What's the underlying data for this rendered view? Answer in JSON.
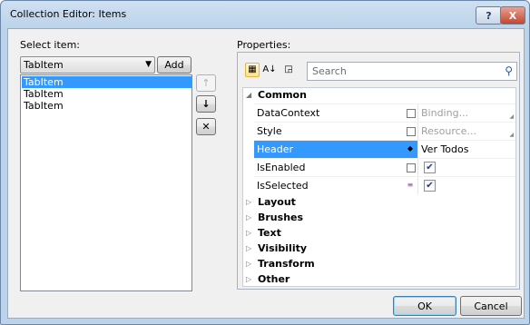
{
  "window": {
    "title": "Collection Editor: Items",
    "help_glyph": "?",
    "close_glyph": "X"
  },
  "left": {
    "label": "Select item:",
    "combo_value": "TabItem",
    "add_label": "Add",
    "items": [
      {
        "label": "TabItem",
        "selected": true
      },
      {
        "label": "TabItem",
        "selected": false
      },
      {
        "label": "TabItem",
        "selected": false
      }
    ],
    "move_up_glyph": "↑",
    "move_down_glyph": "↓",
    "remove_glyph": "✕"
  },
  "properties": {
    "label": "Properties:",
    "search_placeholder": "Search",
    "categories_expanded": "Common",
    "rows": [
      {
        "name": "DataContext",
        "value": "Binding...",
        "dim": true
      },
      {
        "name": "Style",
        "value": "Resource...",
        "dim": true
      },
      {
        "name": "Header",
        "value": "Ver Todos",
        "dim": false,
        "selected": true
      },
      {
        "name": "IsEnabled",
        "checked": true
      },
      {
        "name": "IsSelected",
        "checked": true
      }
    ],
    "collapsed_categories": [
      "Layout",
      "Brushes",
      "Text",
      "Visibility",
      "Transform",
      "Other"
    ]
  },
  "footer": {
    "ok_label": "OK",
    "cancel_label": "Cancel"
  }
}
